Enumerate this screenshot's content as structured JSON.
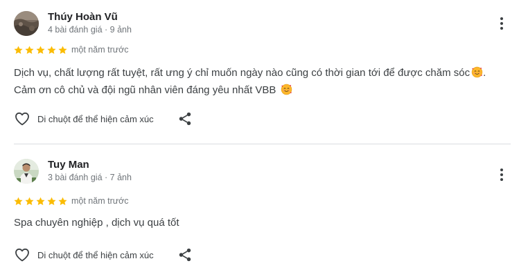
{
  "colors": {
    "star": "#fbbc04",
    "secondary_text": "#70757a",
    "body_text": "#3c4043",
    "divider": "#dadce0"
  },
  "reviews": [
    {
      "author": "Thúy Hoàn Vũ",
      "meta": "4 bài đánh giá · 9 ảnh",
      "rating": 5,
      "time": "một năm trước",
      "lines": [
        "Dịch vụ, chất lượng rất tuyệt, rất ưng ý chỉ muốn ngày nào cũng có thời gian tới để được chăm sóc",
        "Cảm ơn cô chủ và đội ngũ nhân viên đáng yêu nhất VBB"
      ],
      "emoji": "smiling-face-with-hearts-emoji",
      "like_label": "Di chuột để thể hiện cảm xúc"
    },
    {
      "author": "Tuy Man",
      "meta": "3 bài đánh giá · 7 ảnh",
      "rating": 5,
      "time": "một năm trước",
      "lines": [
        "Spa chuyên nghiệp , dịch vụ quá tốt"
      ],
      "like_label": "Di chuột để thể hiện cảm xúc"
    }
  ],
  "icons": {
    "more": "more-vert-icon",
    "like": "heart-outline-icon",
    "share": "share-icon",
    "star": "star-icon"
  }
}
